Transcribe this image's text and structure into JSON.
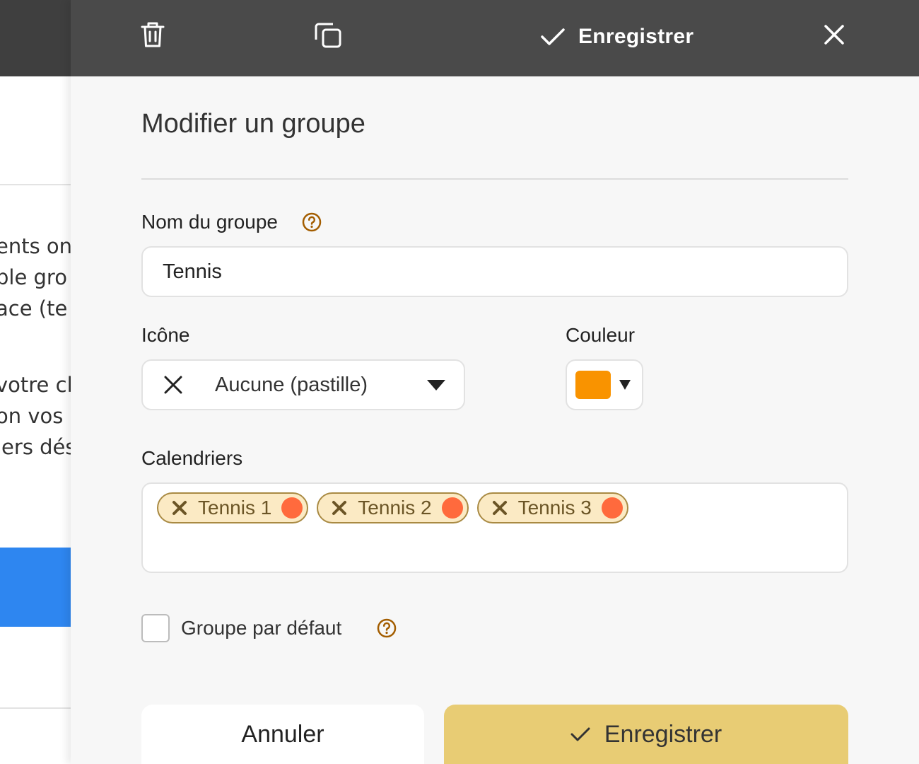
{
  "background": {
    "text_lines_1": [
      "ents on",
      "ple gro",
      "ace (te"
    ],
    "text_lines_2": [
      "votre cl",
      "on vos c",
      "iers dés"
    ]
  },
  "toolbar": {
    "delete_icon": "trash-icon",
    "duplicate_icon": "copy-icon",
    "save_label": "Enregistrer",
    "close_icon": "close-icon"
  },
  "form": {
    "title": "Modifier un groupe",
    "name_label": "Nom du groupe",
    "name_value": "Tennis",
    "icon_label": "Icône",
    "icon_value": "Aucune (pastille)",
    "color_label": "Couleur",
    "color_value": "#f99300",
    "calendars_label": "Calendriers",
    "calendars": [
      {
        "label": "Tennis 1",
        "color": "#ff6a3d"
      },
      {
        "label": "Tennis 2",
        "color": "#ff6a3d"
      },
      {
        "label": "Tennis 3",
        "color": "#ff6a3d"
      }
    ],
    "default_label": "Groupe par défaut",
    "default_checked": false
  },
  "actions": {
    "cancel_label": "Annuler",
    "save_label": "Enregistrer"
  },
  "colors": {
    "topbar": "#4a4a4a",
    "accent": "#e8cc74",
    "help": "#a35d00",
    "background_blue": "#2e86f0"
  }
}
